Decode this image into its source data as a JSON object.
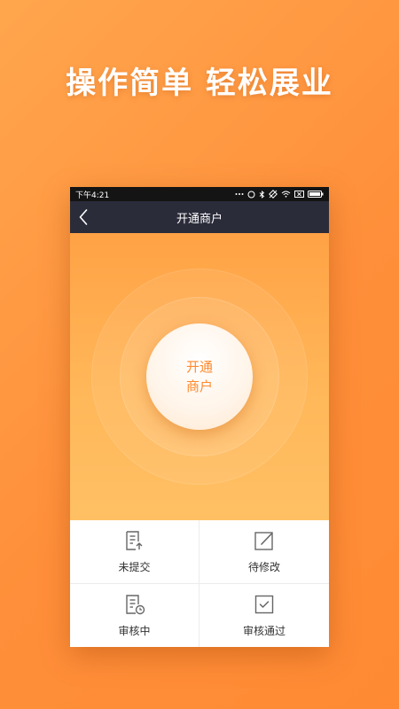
{
  "headline": "操作简单 轻松展业",
  "status_bar": {
    "time": "下午4:21"
  },
  "nav": {
    "title": "开通商户"
  },
  "hero": {
    "button_label": "开通商户"
  },
  "grid": {
    "items": [
      {
        "label": "未提交",
        "icon": "document-upload-icon"
      },
      {
        "label": "待修改",
        "icon": "edit-icon"
      },
      {
        "label": "审核中",
        "icon": "document-clock-icon"
      },
      {
        "label": "审核通过",
        "icon": "checkbox-icon"
      }
    ]
  },
  "colors": {
    "accent": "#ff8a2e",
    "nav_bg": "#2a2c3a",
    "page_bg": "#ff9a40"
  }
}
